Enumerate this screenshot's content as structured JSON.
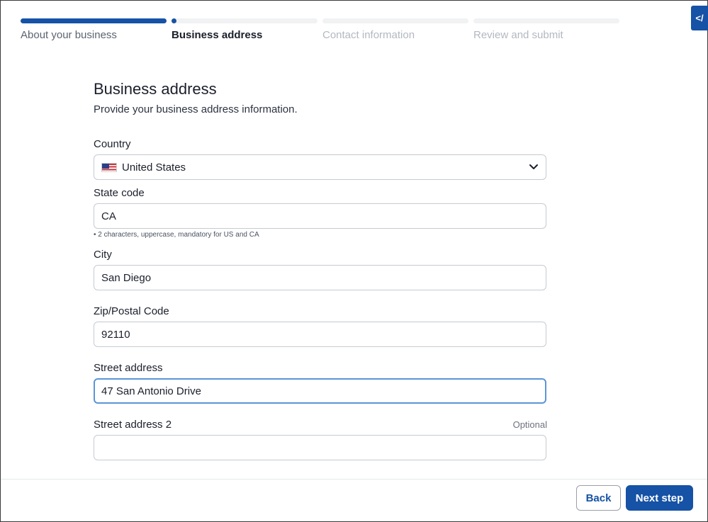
{
  "stepper": {
    "steps": [
      {
        "label": "About your business",
        "state": "done"
      },
      {
        "label": "Business address",
        "state": "current"
      },
      {
        "label": "Contact information",
        "state": "future"
      },
      {
        "label": "Review and submit",
        "state": "future"
      }
    ]
  },
  "dev_toggle": {
    "icon": "code-icon",
    "glyph": "</"
  },
  "form": {
    "title": "Business address",
    "subtitle": "Provide your business address information.",
    "country": {
      "label": "Country",
      "value": "United States",
      "flag_icon": "us-flag-icon"
    },
    "state_code": {
      "label": "State code",
      "value": "CA",
      "hint": "• 2 characters, uppercase, mandatory for US and CA"
    },
    "city": {
      "label": "City",
      "value": "San Diego"
    },
    "zip": {
      "label": "Zip/Postal Code",
      "value": "92110"
    },
    "street": {
      "label": "Street address",
      "value": "47 San Antonio Drive"
    },
    "street2": {
      "label": "Street address 2",
      "value": "",
      "optional_label": "Optional"
    }
  },
  "footer": {
    "back_label": "Back",
    "next_label": "Next step"
  },
  "colors": {
    "accent": "#1652a5",
    "focus_border": "#5b95d6"
  }
}
